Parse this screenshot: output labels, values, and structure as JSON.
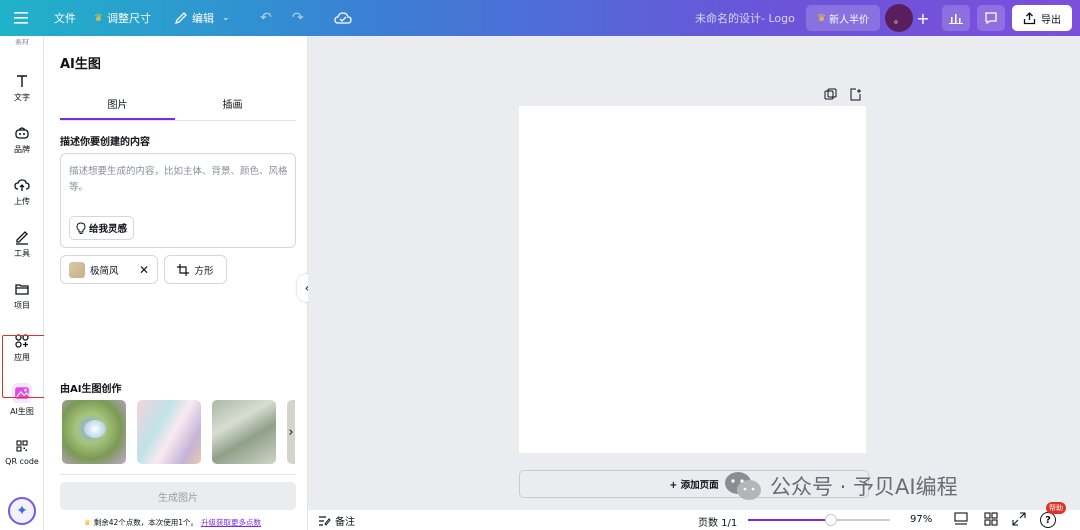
{
  "topbar": {
    "file": "文件",
    "resize": "调整尺寸",
    "edit": "编辑",
    "design_title": "未命名的设计- Logo",
    "promo": "新人半价",
    "avatar_initial": "。",
    "export": "导出"
  },
  "sidebar": {
    "items": [
      {
        "label": "文字",
        "icon": "text-icon"
      },
      {
        "label": "品牌",
        "icon": "brand-icon"
      },
      {
        "label": "上传",
        "icon": "upload-icon"
      },
      {
        "label": "工具",
        "icon": "pen-icon"
      },
      {
        "label": "项目",
        "icon": "folder-icon"
      },
      {
        "label": "应用",
        "icon": "apps-icon"
      },
      {
        "label": "AI生图",
        "icon": "ai-image-icon"
      },
      {
        "label": "QR code",
        "icon": "qr-icon"
      }
    ],
    "top_cut_label": "素材"
  },
  "panel": {
    "title": "AI生图",
    "tabs": [
      "图片",
      "插画"
    ],
    "describe_heading": "描述你要创建的内容",
    "prompt_placeholder": "描述想要生成的内容，比如主体、背景、颜色、风格等。",
    "inspire_button": "给我灵感",
    "style_chip": "极简风",
    "shape_chip": "方形",
    "gallery_heading": "由AI生图创作",
    "generate_button": "生成图片",
    "credits_text": "剩余42个点数，本次使用1个。",
    "upgrade_link": "升级获取更多点数"
  },
  "canvas": {
    "add_page": "+ 添加页面",
    "watermark": "公众号 · 予贝AI编程"
  },
  "bottombar": {
    "notes": "备注",
    "page_count": "页数 1/1",
    "zoom": "97%",
    "help_badge": "帮助",
    "zoom_level": 0.97
  },
  "colors": {
    "accent": "#7d2ae8",
    "active_border": "#e0322a",
    "crown": "#f5b100"
  }
}
